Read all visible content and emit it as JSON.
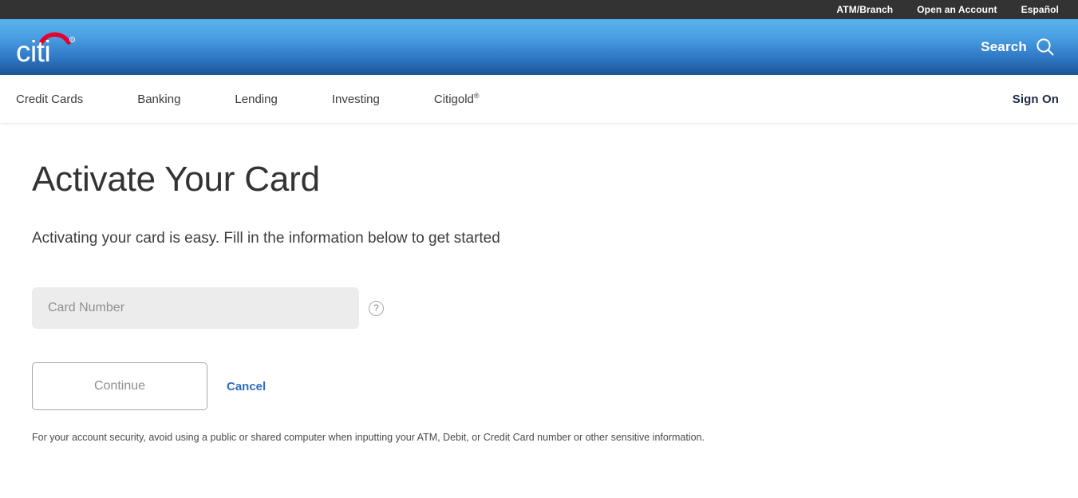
{
  "utility_bar": {
    "links": [
      {
        "label": "ATM/Branch",
        "name": "utility-link-atm-branch"
      },
      {
        "label": "Open an Account",
        "name": "utility-link-open-account"
      },
      {
        "label": "Español",
        "name": "utility-link-espanol"
      }
    ]
  },
  "brand_bar": {
    "logo_text": "citi",
    "logo_trademark": "®",
    "search_label": "Search",
    "search_icon": "search-icon"
  },
  "nav_bar": {
    "items": [
      {
        "label": "Credit Cards"
      },
      {
        "label": "Banking"
      },
      {
        "label": "Lending"
      },
      {
        "label": "Investing"
      },
      {
        "label": "Citigold",
        "sup": "®"
      }
    ],
    "sign_on_label": "Sign On"
  },
  "main": {
    "title": "Activate Your Card",
    "subtitle": "Activating your card is easy. Fill in the information below to get started",
    "card_number_field": {
      "placeholder": "Card Number",
      "value": ""
    },
    "help_icon_label": "?",
    "continue_label": "Continue",
    "cancel_label": "Cancel",
    "disclaimer": "For your account security, avoid using a public or shared computer when inputting your ATM, Debit, or Credit Card number or other sensitive information."
  },
  "colors": {
    "utility_bar_bg": "#333333",
    "brand_gradient_top": "#58b4ee",
    "brand_gradient_bottom": "#1d5496",
    "logo_arc_red": "#e4002b",
    "link_blue": "#2c6cc9",
    "sign_on_navy": "#1c2b46",
    "input_bg": "#ececec",
    "page_bg": "#ffffff"
  }
}
